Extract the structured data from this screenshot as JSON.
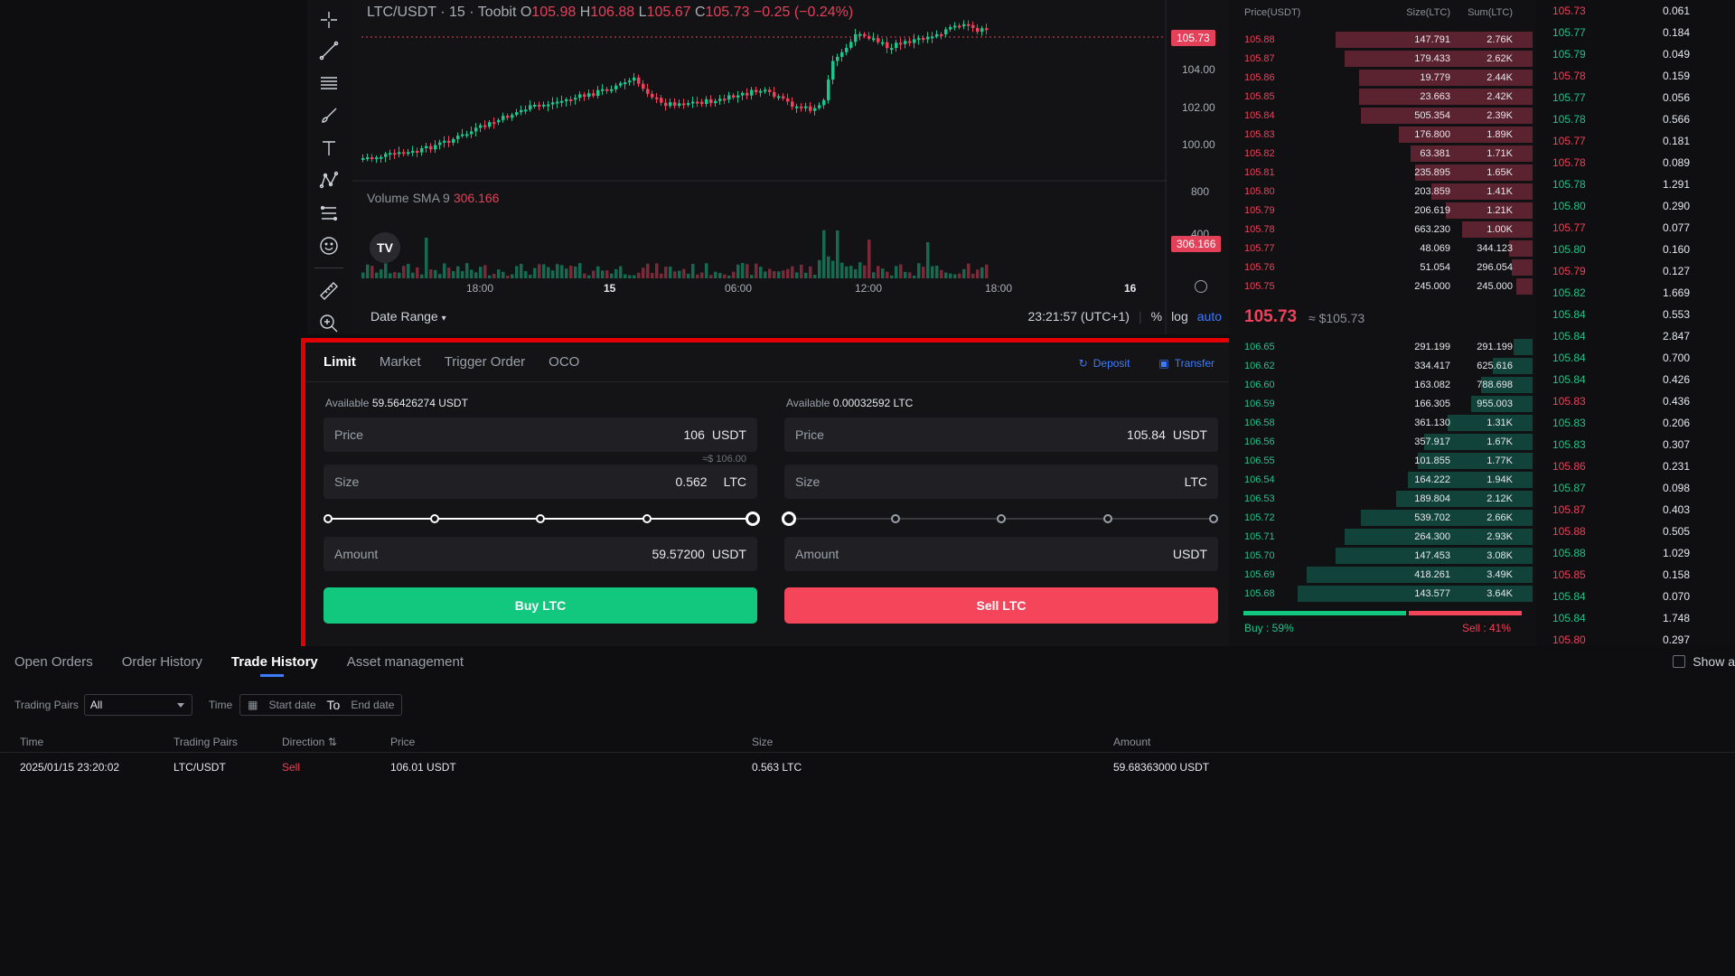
{
  "chart": {
    "header": {
      "symbol": "LTC/USDT · 15 · Toobit",
      "o_label": "O",
      "o_value": "105.98",
      "h_label": "H",
      "h_value": "106.88",
      "l_label": "L",
      "l_value": "105.67",
      "c_label": "C",
      "c_value": "105.73",
      "change": "−0.25 (−0.24%)"
    },
    "price_axis": [
      "104.00",
      "102.00",
      "100.00"
    ],
    "last_price_tag": "105.73",
    "volume_axis": [
      "800",
      "400"
    ],
    "volume_label": "Volume SMA 9",
    "volume_value": "306.166",
    "volume_tag": "306.166",
    "time_axis": [
      "18:00",
      "15",
      "06:00",
      "12:00",
      "18:00",
      "16"
    ],
    "date_range": "Date Range",
    "clock": "23:21:57 (UTC+1)",
    "percent_btn": "%",
    "log_btn": "log",
    "auto_btn": "auto"
  },
  "order_panel": {
    "tabs": [
      "Limit",
      "Market",
      "Trigger Order",
      "OCO"
    ],
    "active_tab": "Limit",
    "deposit": "Deposit",
    "transfer": "Transfer",
    "buy": {
      "available_label": "Available",
      "available_value": "59.56426274 USDT",
      "price_label": "Price",
      "price_value": "106",
      "price_unit": "USDT",
      "price_hint": "≈$ 106.00",
      "size_label": "Size",
      "size_value": "0.562",
      "size_unit": "LTC",
      "slider_fraction": 1.0,
      "amount_label": "Amount",
      "amount_value": "59.57200",
      "amount_unit": "USDT",
      "button": "Buy LTC"
    },
    "sell": {
      "available_label": "Available",
      "available_value": "0.00032592 LTC",
      "price_label": "Price",
      "price_value": "105.84",
      "price_unit": "USDT",
      "size_label": "Size",
      "size_value": "",
      "size_unit": "LTC",
      "slider_fraction": 0.0,
      "amount_label": "Amount",
      "amount_value": "",
      "amount_unit": "USDT",
      "button": "Sell LTC"
    }
  },
  "orderbook": {
    "headers": [
      "Price(USDT)",
      "Size(LTC)",
      "Sum(LTC)"
    ],
    "asks": [
      {
        "p": "105.88",
        "s": "147.791",
        "t": "2.76K",
        "f": 0.84
      },
      {
        "p": "105.87",
        "s": "179.433",
        "t": "2.62K",
        "f": 0.8
      },
      {
        "p": "105.86",
        "s": "19.779",
        "t": "2.44K",
        "f": 0.74
      },
      {
        "p": "105.85",
        "s": "23.663",
        "t": "2.42K",
        "f": 0.74
      },
      {
        "p": "105.84",
        "s": "505.354",
        "t": "2.39K",
        "f": 0.73
      },
      {
        "p": "105.83",
        "s": "176.800",
        "t": "1.89K",
        "f": 0.57
      },
      {
        "p": "105.82",
        "s": "63.381",
        "t": "1.71K",
        "f": 0.52
      },
      {
        "p": "105.81",
        "s": "235.895",
        "t": "1.65K",
        "f": 0.5
      },
      {
        "p": "105.80",
        "s": "203.859",
        "t": "1.41K",
        "f": 0.43
      },
      {
        "p": "105.79",
        "s": "206.619",
        "t": "1.21K",
        "f": 0.37
      },
      {
        "p": "105.78",
        "s": "663.230",
        "t": "1.00K",
        "f": 0.3
      },
      {
        "p": "105.77",
        "s": "48.069",
        "t": "344.123",
        "f": 0.1
      },
      {
        "p": "105.76",
        "s": "51.054",
        "t": "296.054",
        "f": 0.09
      },
      {
        "p": "105.75",
        "s": "245.000",
        "t": "245.000",
        "f": 0.07
      }
    ],
    "mid_price": "105.73",
    "mid_usd": "≈ $105.73",
    "bids": [
      {
        "p": "106.65",
        "s": "291.199",
        "t": "291.199",
        "f": 0.08
      },
      {
        "p": "106.62",
        "s": "334.417",
        "t": "625.616",
        "f": 0.17
      },
      {
        "p": "106.60",
        "s": "163.082",
        "t": "788.698",
        "f": 0.22
      },
      {
        "p": "106.59",
        "s": "166.305",
        "t": "955.003",
        "f": 0.26
      },
      {
        "p": "106.58",
        "s": "361.130",
        "t": "1.31K",
        "f": 0.36
      },
      {
        "p": "106.56",
        "s": "357.917",
        "t": "1.67K",
        "f": 0.46
      },
      {
        "p": "106.55",
        "s": "101.855",
        "t": "1.77K",
        "f": 0.49
      },
      {
        "p": "106.54",
        "s": "164.222",
        "t": "1.94K",
        "f": 0.53
      },
      {
        "p": "106.53",
        "s": "189.804",
        "t": "2.12K",
        "f": 0.58
      },
      {
        "p": "105.72",
        "s": "539.702",
        "t": "2.66K",
        "f": 0.73
      },
      {
        "p": "105.71",
        "s": "264.300",
        "t": "2.93K",
        "f": 0.8
      },
      {
        "p": "105.70",
        "s": "147.453",
        "t": "3.08K",
        "f": 0.84
      },
      {
        "p": "105.69",
        "s": "418.261",
        "t": "3.49K",
        "f": 0.96
      },
      {
        "p": "105.68",
        "s": "143.577",
        "t": "3.64K",
        "f": 1.0
      }
    ],
    "buy_ratio": 0.59,
    "buy_label": "Buy : 59%",
    "sell_label": "Sell : 41%"
  },
  "trades": [
    {
      "p": "105.73",
      "s": "0.061",
      "d": "dn"
    },
    {
      "p": "105.77",
      "s": "0.184",
      "d": "up"
    },
    {
      "p": "105.79",
      "s": "0.049",
      "d": "up"
    },
    {
      "p": "105.78",
      "s": "0.159",
      "d": "dn"
    },
    {
      "p": "105.77",
      "s": "0.056",
      "d": "up"
    },
    {
      "p": "105.78",
      "s": "0.566",
      "d": "up"
    },
    {
      "p": "105.77",
      "s": "0.181",
      "d": "dn"
    },
    {
      "p": "105.78",
      "s": "0.089",
      "d": "dn"
    },
    {
      "p": "105.78",
      "s": "1.291",
      "d": "up"
    },
    {
      "p": "105.80",
      "s": "0.290",
      "d": "up"
    },
    {
      "p": "105.77",
      "s": "0.077",
      "d": "dn"
    },
    {
      "p": "105.80",
      "s": "0.160",
      "d": "up"
    },
    {
      "p": "105.79",
      "s": "0.127",
      "d": "dn"
    },
    {
      "p": "105.82",
      "s": "1.669",
      "d": "up"
    },
    {
      "p": "105.84",
      "s": "0.553",
      "d": "up"
    },
    {
      "p": "105.84",
      "s": "2.847",
      "d": "up"
    },
    {
      "p": "105.84",
      "s": "0.700",
      "d": "up"
    },
    {
      "p": "105.84",
      "s": "0.426",
      "d": "up"
    },
    {
      "p": "105.83",
      "s": "0.436",
      "d": "dn"
    },
    {
      "p": "105.83",
      "s": "0.206",
      "d": "up"
    },
    {
      "p": "105.83",
      "s": "0.307",
      "d": "up"
    },
    {
      "p": "105.86",
      "s": "0.231",
      "d": "dn"
    },
    {
      "p": "105.87",
      "s": "0.098",
      "d": "up"
    },
    {
      "p": "105.87",
      "s": "0.403",
      "d": "dn"
    },
    {
      "p": "105.88",
      "s": "0.505",
      "d": "dn"
    },
    {
      "p": "105.88",
      "s": "1.029",
      "d": "up"
    },
    {
      "p": "105.85",
      "s": "0.158",
      "d": "dn"
    },
    {
      "p": "105.84",
      "s": "0.070",
      "d": "up"
    },
    {
      "p": "105.84",
      "s": "1.748",
      "d": "up"
    },
    {
      "p": "105.80",
      "s": "0.297",
      "d": "dn"
    }
  ],
  "bottom": {
    "tabs": [
      "Open Orders",
      "Order History",
      "Trade History",
      "Asset management"
    ],
    "active_tab": "Trade History",
    "show_all": "Show a",
    "filters": {
      "pairs_label": "Trading Pairs",
      "pairs_value": "All",
      "time_label": "Time",
      "start_placeholder": "Start date",
      "to": "To",
      "end_placeholder": "End date"
    },
    "columns": [
      "Time",
      "Trading Pairs",
      "Direction",
      "Price",
      "Size",
      "Amount"
    ],
    "rows": [
      {
        "time": "2025/01/15 23:20:02",
        "pair": "LTC/USDT",
        "direction": "Sell",
        "price": "106.01 USDT",
        "size": "0.563 LTC",
        "amount": "59.68363000 USDT"
      }
    ]
  },
  "colors": {
    "buy": "#12c77e",
    "sell": "#f4455b",
    "accent": "#3d7bff",
    "highlight": "#e50000"
  }
}
